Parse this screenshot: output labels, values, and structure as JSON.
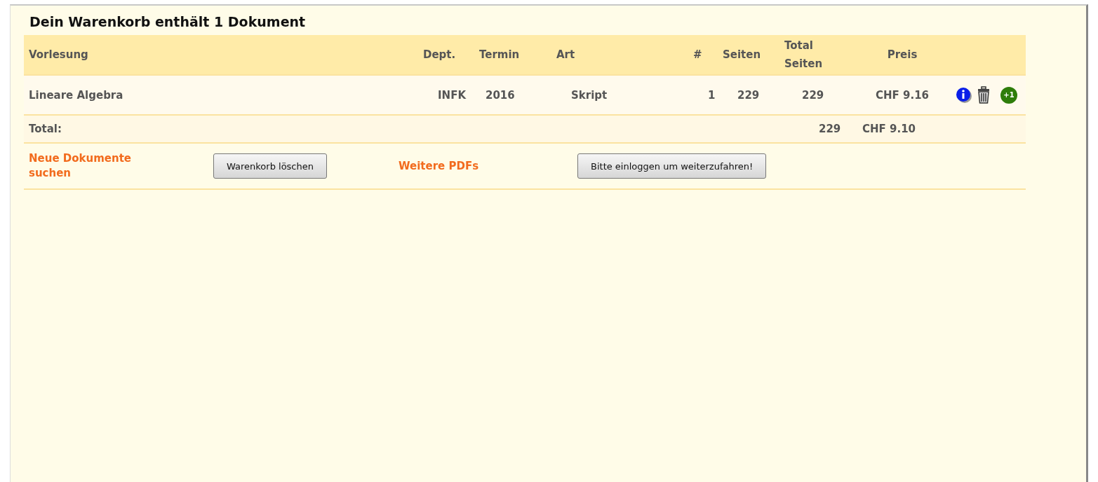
{
  "title": "Dein Warenkorb enthält 1 Dokument",
  "table": {
    "columns": [
      "Vorlesung",
      "Dept.",
      "Termin",
      "Art",
      "#",
      "Seiten",
      "Total Seiten",
      "Preis"
    ],
    "rows": [
      {
        "cells": [
          "Lineare Algebra",
          "INFK",
          "2016",
          "Skript",
          "1",
          "229",
          "229",
          "CHF 9.16"
        ],
        "add_badge": "+1"
      }
    ]
  },
  "total": {
    "label": "Total:",
    "pages": "229",
    "price": "CHF 9.10"
  },
  "actions": [
    {
      "kind": "link",
      "label": "Neue Dokumente suchen"
    },
    {
      "kind": "button",
      "label": "Warenkorb löschen"
    },
    {
      "kind": "link",
      "label": "Weitere PDFs"
    },
    {
      "kind": "button",
      "label": "Bitte einloggen um weiterzufahren!"
    }
  ]
}
